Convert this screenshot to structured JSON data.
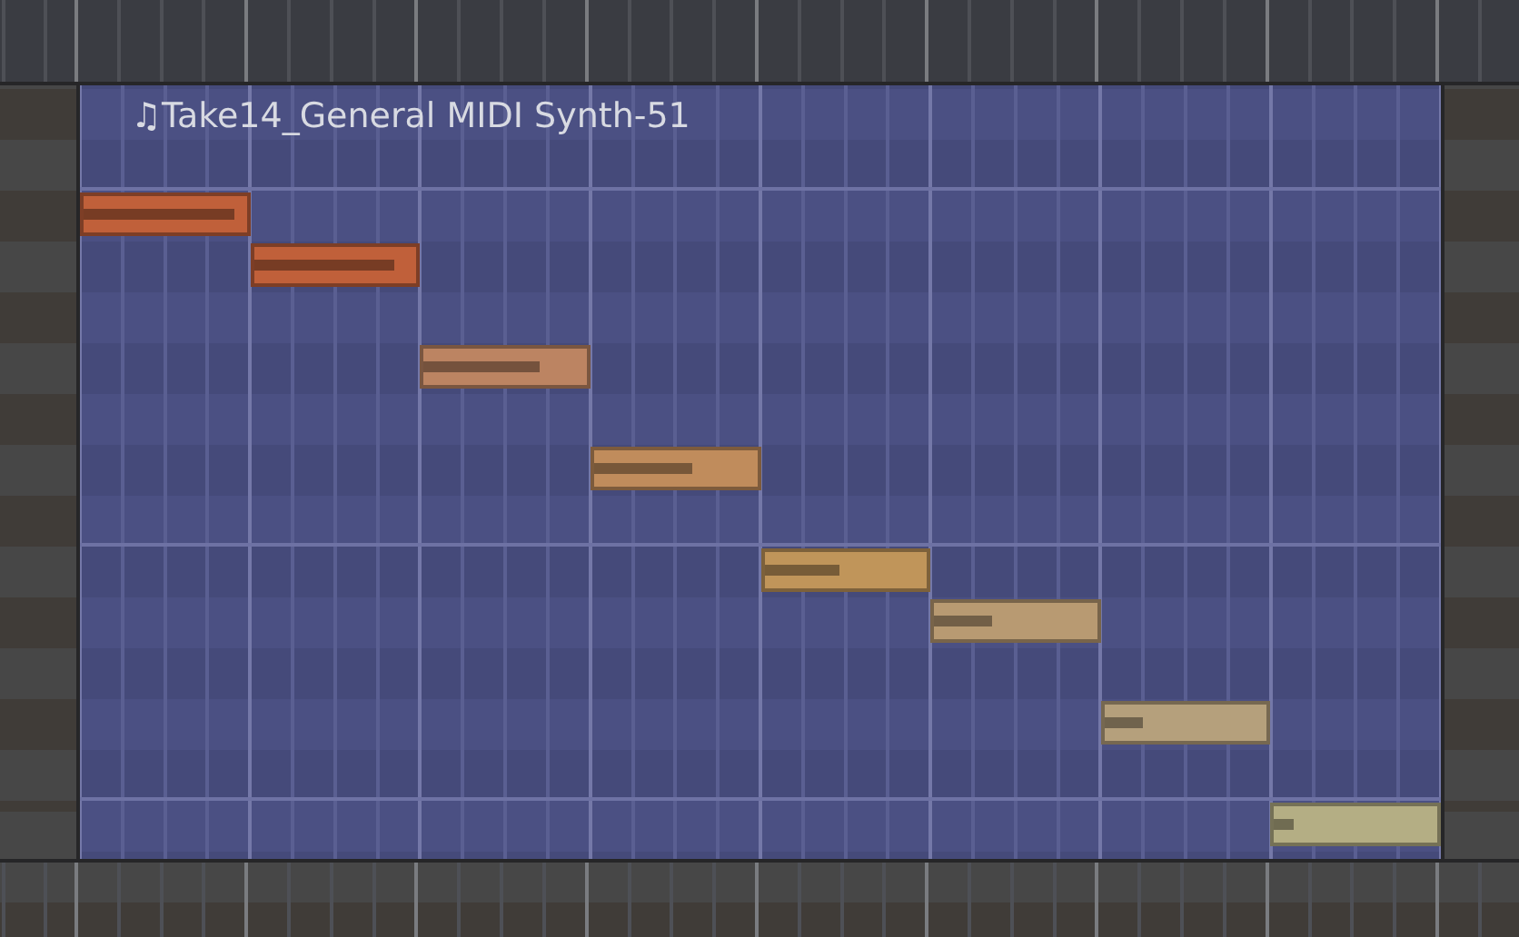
{
  "clip": {
    "title": "♫Take14_General MIDI Synth-51",
    "notes": [
      {
        "color": "#c0603a",
        "level": 0.93
      },
      {
        "color": "#c0603a",
        "level": 0.86,
        "kind": "half"
      },
      {
        "color": "#bc8462",
        "level": 0.71,
        "kind": "whole"
      },
      {
        "color": "#c08c5c",
        "level": 0.6,
        "kind": "whole"
      },
      {
        "color": "#c0955a",
        "level": 0.46,
        "kind": "whole"
      },
      {
        "color": "#b89a72",
        "level": 0.36,
        "kind": "half"
      },
      {
        "color": "#b5a07c",
        "level": 0.24,
        "kind": "whole"
      },
      {
        "color": "#b4ae84",
        "level": 0.12,
        "kind": "whole"
      }
    ]
  }
}
